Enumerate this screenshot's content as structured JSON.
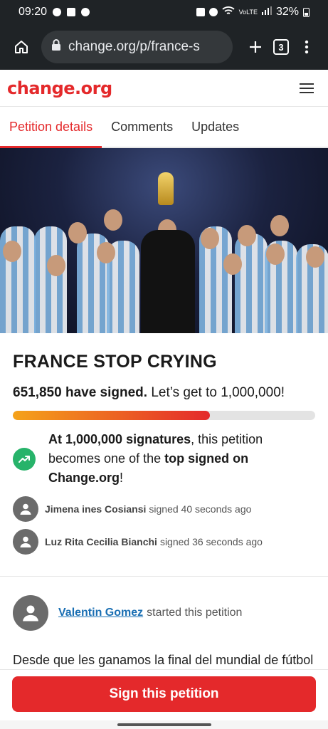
{
  "status_bar": {
    "time": "09:20",
    "battery": "32%",
    "network": "VoLTE"
  },
  "browser": {
    "url": "change.org/p/france-s",
    "tab_count": "3"
  },
  "site": {
    "logo": "change.org"
  },
  "tabs": [
    {
      "label": "Petition details",
      "active": true
    },
    {
      "label": "Comments",
      "active": false
    },
    {
      "label": "Updates",
      "active": false
    }
  ],
  "petition": {
    "title": "FRANCE STOP CRYING",
    "signed_count": "651,850 have signed.",
    "goal_text": "Let’s get to 1,000,000!",
    "progress": 0.652,
    "milestone": {
      "part1": "At 1,000,000 signatures",
      "part2": ", this petition becomes one of the ",
      "part3": "top signed on Change.org",
      "part4": "!"
    },
    "recent_signers": [
      {
        "name": "Jimena ines Cosiansi",
        "action": "signed 40 seconds ago"
      },
      {
        "name": "Luz Rita Cecilia Bianchi",
        "action": "signed 36 seconds ago"
      }
    ],
    "starter": {
      "name": "Valentin Gomez",
      "action": "started this petition"
    },
    "description": "Desde que les ganamos la final del mundial de fútbol los franceses no paran de llorar, quejarse y no aceptan que Argentina es el campeón del mundo"
  },
  "cta": {
    "sign_label": "Sign this petition"
  },
  "colors": {
    "brand": "#e4292b",
    "success": "#27b36a",
    "link": "#1a6fb3"
  }
}
